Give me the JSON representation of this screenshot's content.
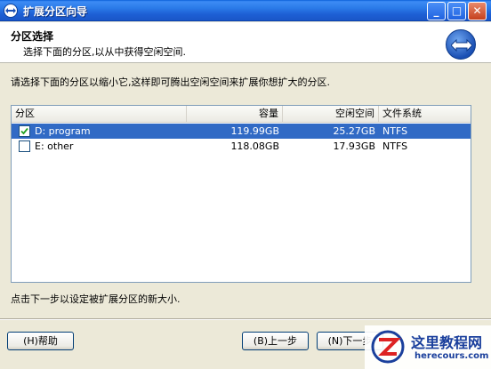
{
  "window": {
    "title": "扩展分区向导"
  },
  "header": {
    "title": "分区选择",
    "subtitle": "选择下面的分区,以从中获得空闲空间."
  },
  "instruction": "请选择下面的分区以缩小它,这样即可腾出空闲空间来扩展你想扩大的分区.",
  "table": {
    "columns": [
      "分区",
      "容量",
      "空闲空间",
      "文件系统"
    ],
    "rows": [
      {
        "name": "D: program",
        "capacity": "119.99GB",
        "free": "25.27GB",
        "fs": "NTFS",
        "checked": true,
        "selected": true
      },
      {
        "name": "E: other",
        "capacity": "118.08GB",
        "free": "17.93GB",
        "fs": "NTFS",
        "checked": false,
        "selected": false
      }
    ]
  },
  "footer_note": "点击下一步以设定被扩展分区的新大小.",
  "buttons": {
    "help": "(H)帮助",
    "prev": "(B)上一步",
    "next": "(N)下一步"
  },
  "watermark": {
    "name": "这里教程网",
    "url": "herecours.com"
  },
  "colors": {
    "selection": "#316ac5",
    "titlebar": "#2a7ae8"
  }
}
